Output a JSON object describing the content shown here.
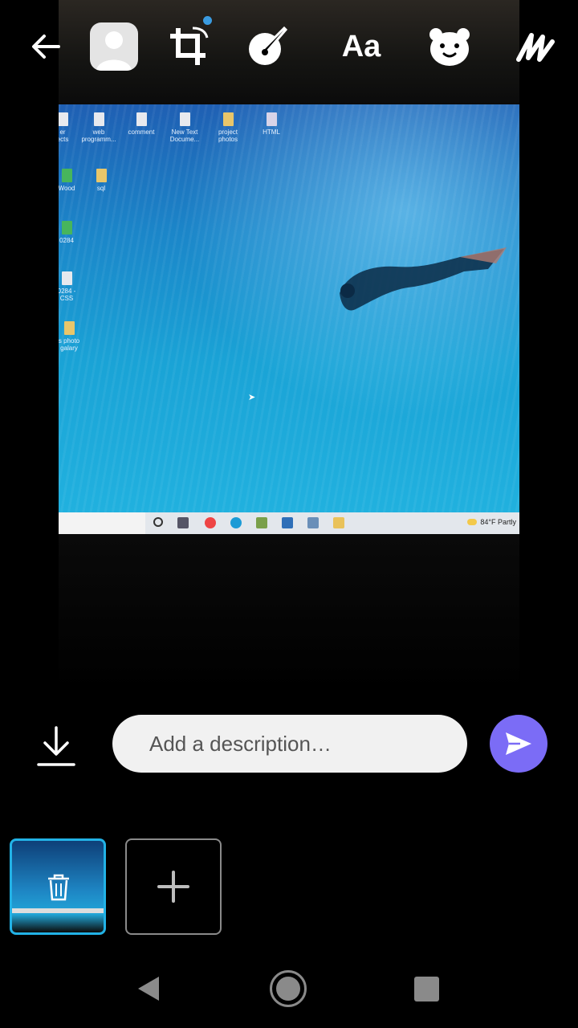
{
  "toolbar": {
    "tools": [
      "back-arrow-icon",
      "profile-icon",
      "crop-rotate-icon",
      "paint-icon",
      "text-icon",
      "sticker-icon",
      "draw-icon"
    ],
    "text_tool_label": "Aa",
    "accent_dot_color": "#3a9be0"
  },
  "photo": {
    "desktop_icons": [
      {
        "label": "er\nects"
      },
      {
        "label": "web\nprogramm..."
      },
      {
        "label": "comment"
      },
      {
        "label": "New Text\nDocume..."
      },
      {
        "label": "project\nphotos"
      },
      {
        "label": "HTML"
      },
      {
        "label": "Wood"
      },
      {
        "label": "sql"
      },
      {
        "label": "0284"
      },
      {
        "label": "0284 -\nCSS"
      },
      {
        "label": "s photo\ngalary"
      }
    ],
    "taskbar_weather": "84°F  Partly"
  },
  "description": {
    "placeholder": "Add a description…"
  },
  "colors": {
    "send_button": "#7b6cf6",
    "thumbnail_border": "#22b2e6",
    "description_bg": "#f1f1f1"
  },
  "thumbnails": {
    "selected_icon": "trash-icon",
    "add_icon": "plus-icon"
  },
  "navbar": {
    "icons": [
      "nav-back-icon",
      "nav-home-icon",
      "nav-recents-icon"
    ]
  }
}
